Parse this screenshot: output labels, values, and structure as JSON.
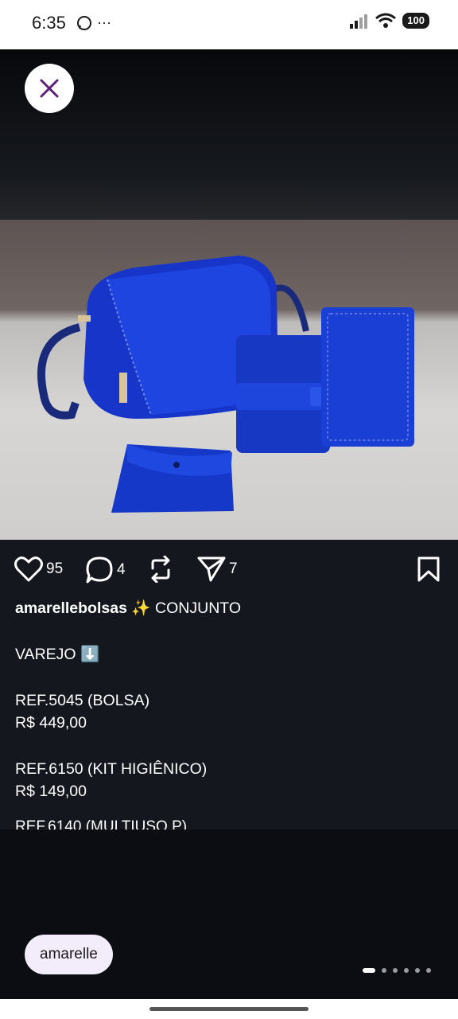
{
  "status_bar": {
    "time": "6:35",
    "more": "···",
    "battery": "100",
    "icons": [
      "whatsapp-icon",
      "signal-icon",
      "wifi-icon",
      "battery-icon"
    ]
  },
  "post": {
    "likes": "95",
    "comments": "4",
    "shares": "7",
    "username": "amarellebolsas",
    "caption_first": "✨ CONJUNTO",
    "caption_lines": [
      "VAREJO ⬇️",
      "REF.5045 (BOLSA)",
      "R$ 449,00",
      "REF.6150 (KIT HIGIÊNICO)",
      "R$ 149,00"
    ],
    "cutoff_line": "REF.6140 (MULTIUSO P)"
  },
  "account_chip": "amarelle",
  "carousel": {
    "count": 6,
    "active_index": 0
  },
  "colors": {
    "accent": "#5b1f7a",
    "product_blue": "#1733c9",
    "panel_bg": "#15171f"
  }
}
